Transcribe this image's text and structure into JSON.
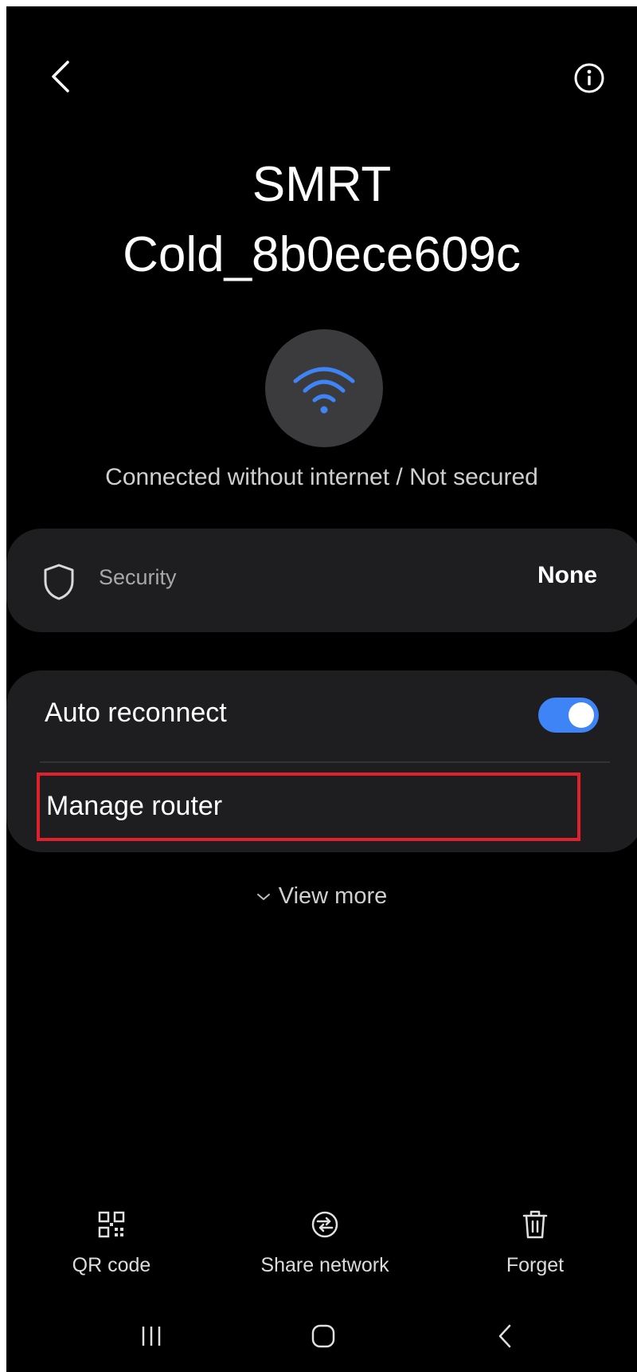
{
  "network": {
    "name_line1": "SMRT",
    "name_line2": "Cold_8b0ece609c",
    "status": "Connected without internet / Not secured"
  },
  "security": {
    "label": "Security",
    "value": "None"
  },
  "settings": {
    "auto_reconnect_label": "Auto reconnect",
    "auto_reconnect_on": true,
    "manage_router_label": "Manage router"
  },
  "view_more_label": "View more",
  "actions": [
    {
      "label": "QR code",
      "icon": "qr-code-icon"
    },
    {
      "label": "Share network",
      "icon": "share-network-icon"
    },
    {
      "label": "Forget",
      "icon": "trash-icon"
    }
  ],
  "nav": [
    "recent-apps-icon",
    "home-icon",
    "back-icon"
  ],
  "colors": {
    "background": "#000000",
    "card": "#1e1e20",
    "accent": "#3f84f6",
    "highlight": "#e0202a"
  }
}
